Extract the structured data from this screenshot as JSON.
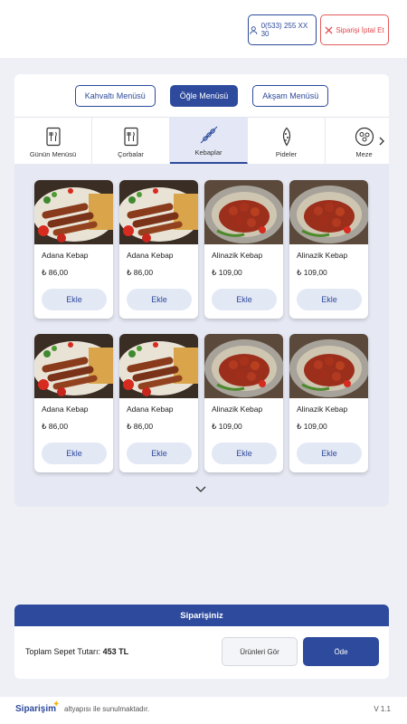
{
  "header": {
    "phone": "0(533) 255 XX 30",
    "cancel_label": "Siparişi İptal Et"
  },
  "menu_tabs": [
    {
      "label": "Kahvaltı Menüsü",
      "active": false
    },
    {
      "label": "Öğle Menüsü",
      "active": true
    },
    {
      "label": "Akşam Menüsü",
      "active": false
    }
  ],
  "categories": [
    {
      "label": "Günün Menüsü",
      "icon": "menu-card-icon",
      "active": false
    },
    {
      "label": "Çorbalar",
      "icon": "menu-card-icon",
      "active": false
    },
    {
      "label": "Kebaplar",
      "icon": "skewer-icon",
      "active": true
    },
    {
      "label": "Pideler",
      "icon": "pide-icon",
      "active": false
    },
    {
      "label": "Meze",
      "icon": "meze-plate-icon",
      "active": false
    }
  ],
  "products": [
    {
      "name": "Adana Kebap",
      "price": "₺ 86,00",
      "add_label": "Ekle",
      "image": "adana"
    },
    {
      "name": "Adana Kebap",
      "price": "₺ 86,00",
      "add_label": "Ekle",
      "image": "adana"
    },
    {
      "name": "Alinazik Kebap",
      "price": "₺ 109,00",
      "add_label": "Ekle",
      "image": "alinazik"
    },
    {
      "name": "Alinazik Kebap",
      "price": "₺ 109,00",
      "add_label": "Ekle",
      "image": "alinazik"
    },
    {
      "name": "Adana Kebap",
      "price": "₺ 86,00",
      "add_label": "Ekle",
      "image": "adana"
    },
    {
      "name": "Adana Kebap",
      "price": "₺ 86,00",
      "add_label": "Ekle",
      "image": "adana"
    },
    {
      "name": "Alinazik Kebap",
      "price": "₺ 109,00",
      "add_label": "Ekle",
      "image": "alinazik"
    },
    {
      "name": "Alinazik Kebap",
      "price": "₺ 109,00",
      "add_label": "Ekle",
      "image": "alinazik"
    }
  ],
  "order": {
    "title": "Siparişiniz",
    "total_label": "Toplam Sepet Tutarı:",
    "total_value": "453 TL",
    "view_label": "Ürünleri Gör",
    "pay_label": "Öde"
  },
  "footer": {
    "brand": "Siparişim",
    "tagline": "altyapısı ile sunulmaktadır.",
    "version": "V 1.1"
  },
  "colors": {
    "primary": "#2d4a9c",
    "danger": "#e0474c",
    "background": "#eef0f6",
    "products_bg": "#e6e9f4",
    "accent": "#f2b705"
  }
}
